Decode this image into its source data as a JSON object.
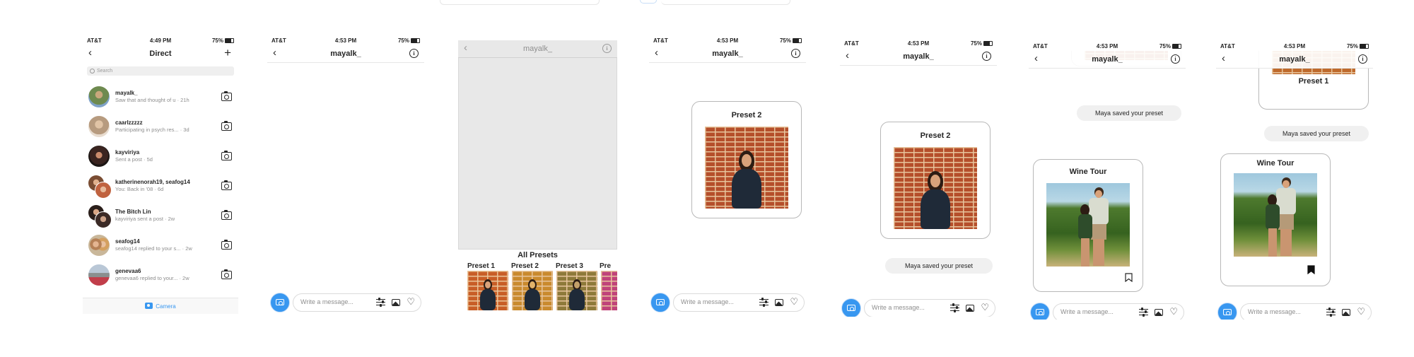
{
  "status": {
    "carrier": "AT&T",
    "battery": "75%",
    "time_direct": "4:49 PM",
    "time_chat": "4:53 PM"
  },
  "direct": {
    "title": "Direct",
    "search_placeholder": "Search",
    "conversations": [
      {
        "name": "mayalk_",
        "preview": "Saw that and thought of u · 21h"
      },
      {
        "name": "caarlzzzzz",
        "preview": "Participating in psych res... · 3d"
      },
      {
        "name": "kayviriya",
        "preview": "Sent a post · 5d"
      },
      {
        "name": "katherinenorah19, seafog14",
        "preview": "You: Back in '08 · 6d"
      },
      {
        "name": "The Bitch Lin",
        "preview": "kayviriya sent a post · 2w"
      },
      {
        "name": "seafog14",
        "preview": "seafog14 replied to your s... · 2w"
      },
      {
        "name": "genevaa6",
        "preview": "genevaa6 replied to your... · 2w"
      }
    ],
    "tab_camera": "Camera"
  },
  "chat": {
    "username": "mayalk_",
    "composer_placeholder": "Write a message...",
    "all_presets": "All Presets",
    "presets": [
      "Preset 1",
      "Preset 2",
      "Preset 3"
    ],
    "card_preset2": "Preset 2",
    "card_preset1": "Preset 1",
    "card_wine": "Wine Tour",
    "saved_msg": "Maya saved your preset"
  },
  "colors": {
    "accent": "#3897f0",
    "text": "#262626",
    "muted": "#8e8e8e",
    "card_border": "#b8b8b8"
  }
}
